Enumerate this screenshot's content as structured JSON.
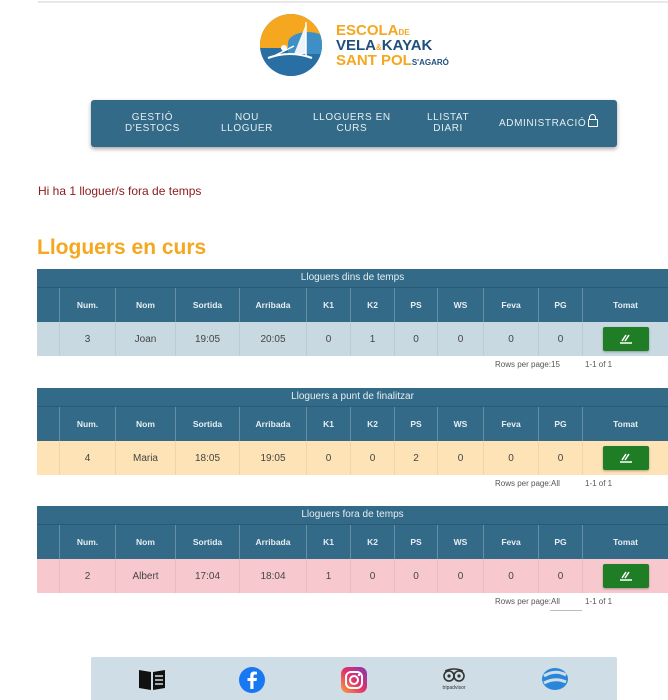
{
  "logo": {
    "line1": "ESCOLA",
    "line1_small": "DE",
    "line2a": "VELA",
    "line2_small": "&",
    "line2b": "KAYAK",
    "line3a": "SANT POL",
    "line3_small": "S'AGARÓ"
  },
  "nav": {
    "items": [
      {
        "line1": "GESTIÓ",
        "line2": "D'ESTOCS"
      },
      {
        "line1": "NOU",
        "line2": "LLOGUER"
      },
      {
        "line1": "LLOGUERS EN",
        "line2": "CURS"
      },
      {
        "line1": "LLISTAT",
        "line2": "DIARI"
      },
      {
        "line1": "ADMINISTRACIÓ",
        "line2": ""
      }
    ]
  },
  "alert_text": "Hi ha 1 lloguer/s fora de temps",
  "heading": "Lloguers en curs",
  "columns": [
    "Num.",
    "Nom",
    "Sortida",
    "Arribada",
    "K1",
    "K2",
    "PS",
    "WS",
    "Feva",
    "PG",
    "Tomat"
  ],
  "tables": [
    {
      "title": "Lloguers dins de temps",
      "row": {
        "num": "3",
        "nom": "Joan",
        "sortida": "19:05",
        "arribada": "20:05",
        "k1": "0",
        "k2": "1",
        "ps": "0",
        "ws": "0",
        "feva": "0",
        "pg": "0"
      },
      "rows_per_page_label": "Rows per page:",
      "rows_per_page_value": "15",
      "range": "1-1 of 1",
      "color": "#c9d9e2"
    },
    {
      "title": "Lloguers a punt de finalitzar",
      "row": {
        "num": "4",
        "nom": "Maria",
        "sortida": "18:05",
        "arribada": "19:05",
        "k1": "0",
        "k2": "0",
        "ps": "2",
        "ws": "0",
        "feva": "0",
        "pg": "0"
      },
      "rows_per_page_label": "Rows per page:",
      "rows_per_page_value": "All",
      "range": "1-1 of 1",
      "color": "#fde3b6"
    },
    {
      "title": "Lloguers fora de temps",
      "row": {
        "num": "2",
        "nom": "Albert",
        "sortida": "17:04",
        "arribada": "18:04",
        "k1": "1",
        "k2": "0",
        "ps": "0",
        "ws": "0",
        "feva": "0",
        "pg": "0"
      },
      "rows_per_page_label": "Rows per page:",
      "rows_per_page_value": "All",
      "range": "1-1 of 1",
      "color": "#f7c9cf"
    }
  ],
  "footer": {
    "tripadvisor_label": "tripadvisor"
  },
  "colors": {
    "primary": "#336a87",
    "accent": "#f4a71f",
    "alert": "#8b1a1a",
    "button": "#1f7d26"
  },
  "icons": [
    "book-icon",
    "facebook-icon",
    "instagram-icon",
    "tripadvisor-icon",
    "web-icon",
    "lock-icon",
    "check-return-icon"
  ]
}
